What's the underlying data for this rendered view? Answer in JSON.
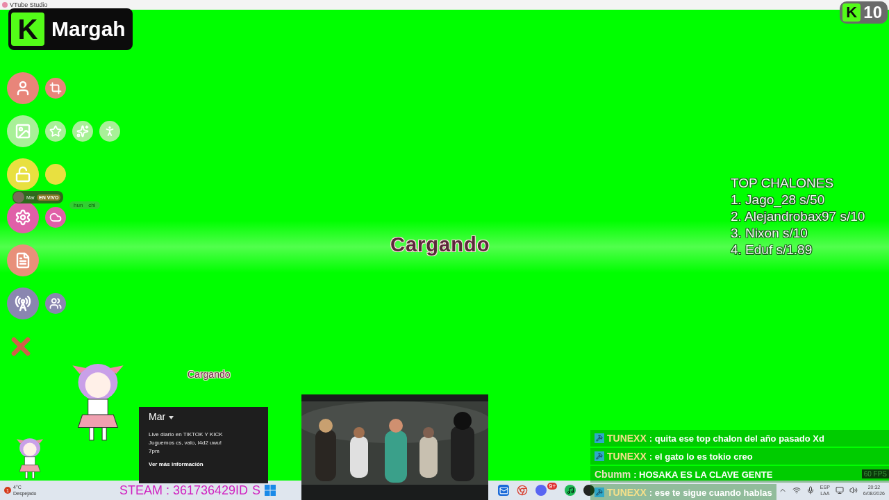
{
  "window": {
    "title": "VTube Studio"
  },
  "brand": {
    "logo_letter": "K",
    "name": "Margah"
  },
  "viewer_badge": {
    "logo_letter": "K",
    "count": "10"
  },
  "live_badge": {
    "name": "Mar",
    "status": "EN VIVO"
  },
  "live_badge_faded": [
    "hun",
    "chl"
  ],
  "loading": {
    "main": "Cargando",
    "small": "Cargando"
  },
  "leaderboard": {
    "title": "TOP CHALONES",
    "entries": [
      "1. Jago_28 s/50",
      "2. Alejandrobax97 s/10",
      "3. Nixon s/10",
      "4. Eduf s/1.89"
    ]
  },
  "profile_card": {
    "name": "Mar",
    "lines": [
      "Live diario en TIKTOK Y KICK",
      "Juguemos cs, valo, l4d2 uwu!",
      "7pm"
    ],
    "link": "Ver más información"
  },
  "video": {
    "kind": "picture"
  },
  "chat": [
    {
      "user": "TUNEXX",
      "text": ": quita ese top chalon del año pasado Xd",
      "badge": true
    },
    {
      "user": "TUNEXX",
      "text": ": el gato lo es tokio creo",
      "badge": true
    },
    {
      "user": "Cbumm",
      "text": ": HOSAKA ES LA CLAVE GENTE",
      "badge": false
    },
    {
      "user": "TUNEXX",
      "text": ": ese te sigue cuando hablas",
      "badge": true
    }
  ],
  "fps": "60 FPS",
  "taskbar": {
    "weather": {
      "alert": "1",
      "temp": "4°C",
      "condition": "Despejado"
    },
    "ticker": [
      "STEAM : 361736429ID",
      "S"
    ],
    "discord_badge": "9+",
    "language": [
      "ESP",
      "LAA"
    ],
    "time": "20:32",
    "date": "6/08/2026"
  }
}
